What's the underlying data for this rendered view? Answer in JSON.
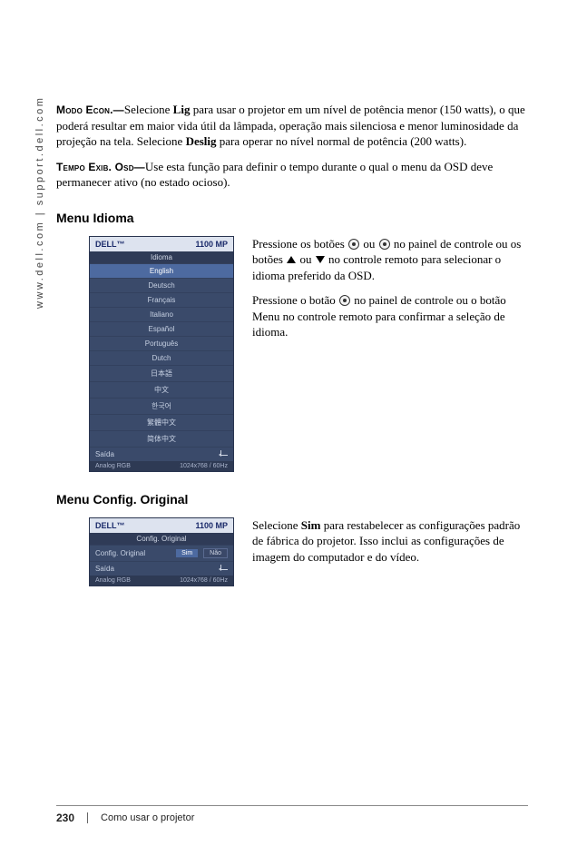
{
  "side_url": "www.dell.com | support.dell.com",
  "para1": {
    "label": "Modo Econ.—",
    "t1": "Selecione ",
    "b1": "Lig",
    "t2": " para usar o projetor em um nível de potência menor (150 watts), o que poderá resultar em maior vida útil da lâmpada, operação mais silenciosa e menor luminosidade da projeção na tela. Selecione ",
    "b2": "Deslig",
    "t3": " para operar no nível normal de potência (200 watts)."
  },
  "para2": {
    "label": "Tempo Exib. Osd—",
    "text": "Use esta função para definir o tempo durante o qual o menu da OSD deve permanecer ativo (no estado ocioso)."
  },
  "section1": {
    "heading": "Menu Idioma",
    "osd": {
      "brand": "DELL™",
      "model": "1100 MP",
      "section": "Idioma",
      "items": [
        "English",
        "Deutsch",
        "Français",
        "Italiano",
        "Español",
        "Português",
        "Dutch",
        "日本語",
        "中文",
        "한국어",
        "繁體中文",
        "简体中文"
      ],
      "exit": "Saída",
      "footer_left": "Analog RGB",
      "footer_right": "1024x768 / 60Hz"
    },
    "text1_a": "Pressione os botões ",
    "text1_b": " ou ",
    "text1_c": " no painel de controle ou os botões ",
    "text1_d": " ou ",
    "text1_e": " no controle remoto para selecionar o idioma preferido da OSD.",
    "text2_a": "Pressione o botão ",
    "text2_b": " no painel de controle ou o botão Menu no controle remoto para confirmar a seleção de idioma."
  },
  "section2": {
    "heading": "Menu Config. Original",
    "osd": {
      "brand": "DELL™",
      "model": "1100 MP",
      "section": "Config. Original",
      "row_label": "Config. Original",
      "yes": "Sim",
      "no": "Não",
      "exit": "Saída",
      "footer_left": "Analog RGB",
      "footer_right": "1024x768 / 60Hz"
    },
    "text_a": "Selecione ",
    "text_b": "Sim",
    "text_c": " para restabelecer as configurações padrão de fábrica do projetor. Isso inclui as configurações de imagem do computador e do vídeo."
  },
  "footer": {
    "page": "230",
    "title": "Como usar o projetor"
  }
}
